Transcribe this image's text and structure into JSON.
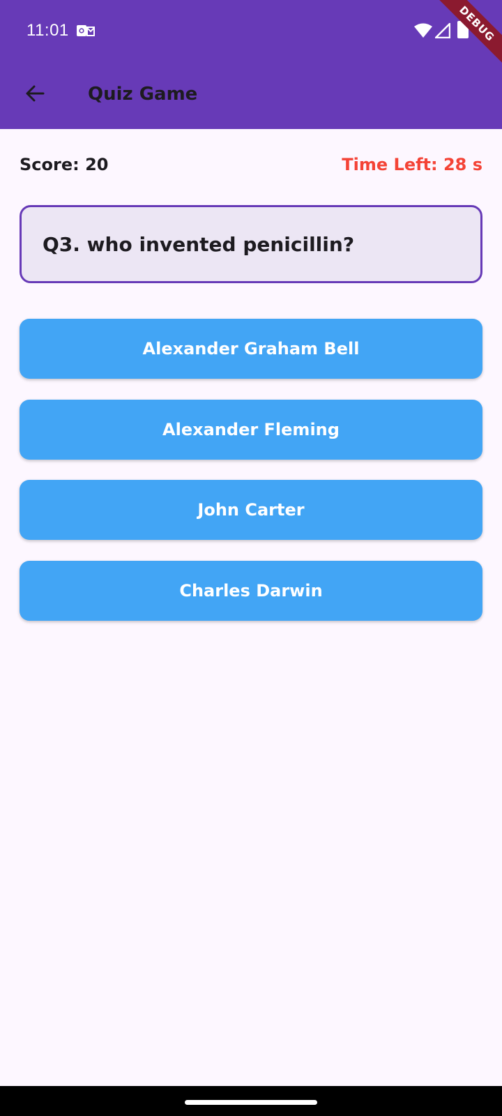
{
  "status_bar": {
    "time": "11:01",
    "icons": [
      "outlook-notification-icon",
      "wifi-icon",
      "signal-icon",
      "battery-icon"
    ]
  },
  "debug_banner": "DEBUG",
  "app_bar": {
    "title": "Quiz Game",
    "back_icon": "arrow-back-icon"
  },
  "game": {
    "score_label": "Score: 20",
    "timer_label": "Time Left: 28 s"
  },
  "question": {
    "text": "Q3. who invented penicillin?"
  },
  "answers": [
    {
      "label": "Alexander Graham Bell"
    },
    {
      "label": "Alexander Fleming"
    },
    {
      "label": "John Carter"
    },
    {
      "label": "Charles Darwin"
    }
  ],
  "colors": {
    "primary": "#673ab7",
    "answer_button": "#42a5f5",
    "timer": "#f44336",
    "background": "#fdf7ff",
    "question_card": "#ece6f4"
  }
}
